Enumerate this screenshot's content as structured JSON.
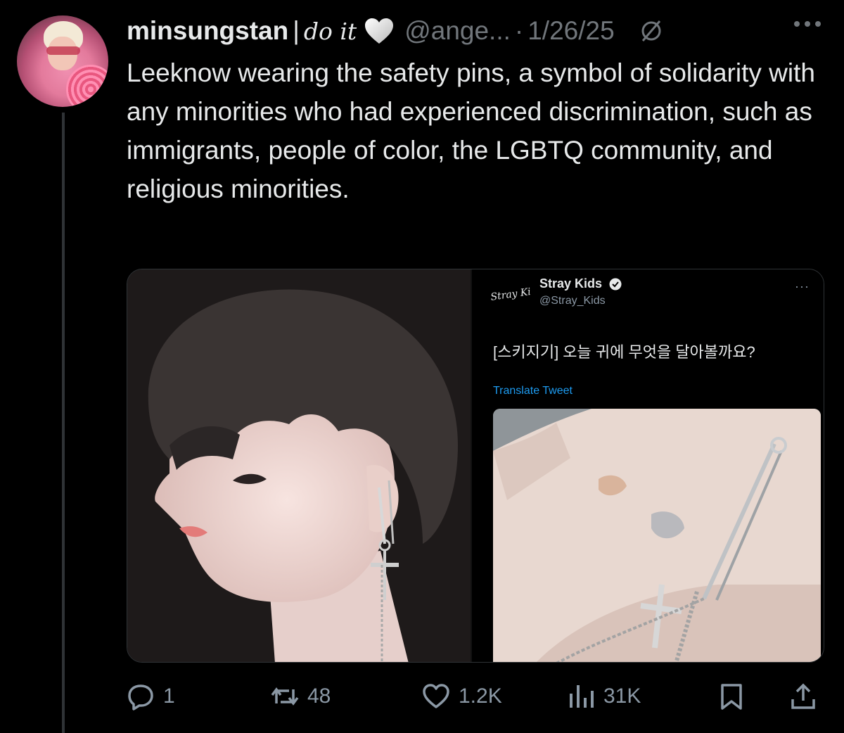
{
  "tweet": {
    "display_name": "minsungstan",
    "name_separator": "|",
    "name_suffix": "do it",
    "handle": "@ange...",
    "dot": "·",
    "date": "1/26/25",
    "text": "Leeknow wearing the safety pins, a symbol of solidarity with any minorities who had experienced discrimination, such as immigrants, people of color, the LGBTQ community, and religious minorities.",
    "icons": {
      "heart": "white-heart-icon",
      "grok": "grok-icon",
      "more": "more-icon"
    }
  },
  "embedded_tweet": {
    "name": "Stray Kids",
    "handle": "@Stray_Kids",
    "more": "···",
    "text": "[스키지기] 오늘 귀에 무엇을 달아볼까요?",
    "translate": "Translate Tweet",
    "logo_text": "Stray Kids"
  },
  "actions": {
    "reply_count": "1",
    "retweet_count": "48",
    "like_count": "1.2K",
    "views_count": "31K"
  },
  "colors": {
    "background": "#000000",
    "text": "#e7e9ea",
    "muted": "#71767b",
    "link": "#1d9bf0"
  }
}
